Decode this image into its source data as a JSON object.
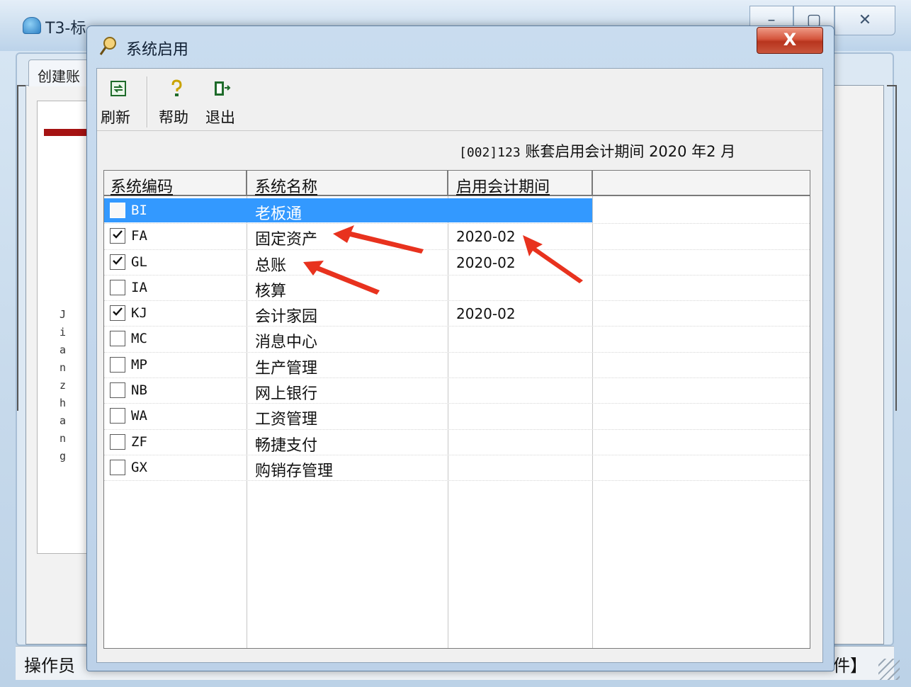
{
  "background_app": {
    "title": "T3-标",
    "tab_label": "创建账",
    "window_controls": {
      "minimize": "–",
      "maximize": "▢",
      "close": "✕"
    },
    "vertical_text": "Jianzhang",
    "status": {
      "operator": "操作员",
      "tail": "件】"
    }
  },
  "dialog": {
    "title": "系统启用",
    "close_label": "X",
    "toolbar": {
      "refresh": "刷新",
      "help": "帮助",
      "exit": "退出"
    },
    "period_info": {
      "prefix": "[002]123",
      "text": "账套启用会计期间 2020 年2 月"
    },
    "columns": {
      "code": "系统编码",
      "name": "系统名称",
      "period": "启用会计期间"
    },
    "rows": [
      {
        "code": "BI",
        "name": "老板通",
        "period": "",
        "checked": false,
        "selected": true
      },
      {
        "code": "FA",
        "name": "固定资产",
        "period": "2020-02",
        "checked": true,
        "selected": false
      },
      {
        "code": "GL",
        "name": "总账",
        "period": "2020-02",
        "checked": true,
        "selected": false
      },
      {
        "code": "IA",
        "name": "核算",
        "period": "",
        "checked": false,
        "selected": false
      },
      {
        "code": "KJ",
        "name": "会计家园",
        "period": "2020-02",
        "checked": true,
        "selected": false
      },
      {
        "code": "MC",
        "name": "消息中心",
        "period": "",
        "checked": false,
        "selected": false
      },
      {
        "code": "MP",
        "name": "生产管理",
        "period": "",
        "checked": false,
        "selected": false
      },
      {
        "code": "NB",
        "name": "网上银行",
        "period": "",
        "checked": false,
        "selected": false
      },
      {
        "code": "WA",
        "name": "工资管理",
        "period": "",
        "checked": false,
        "selected": false
      },
      {
        "code": "ZF",
        "name": "畅捷支付",
        "period": "",
        "checked": false,
        "selected": false
      },
      {
        "code": "GX",
        "name": "购销存管理",
        "period": "",
        "checked": false,
        "selected": false
      }
    ]
  },
  "colors": {
    "selection": "#3399ff",
    "annotation_arrow": "#e8321e",
    "close_button": "#c9452c"
  }
}
